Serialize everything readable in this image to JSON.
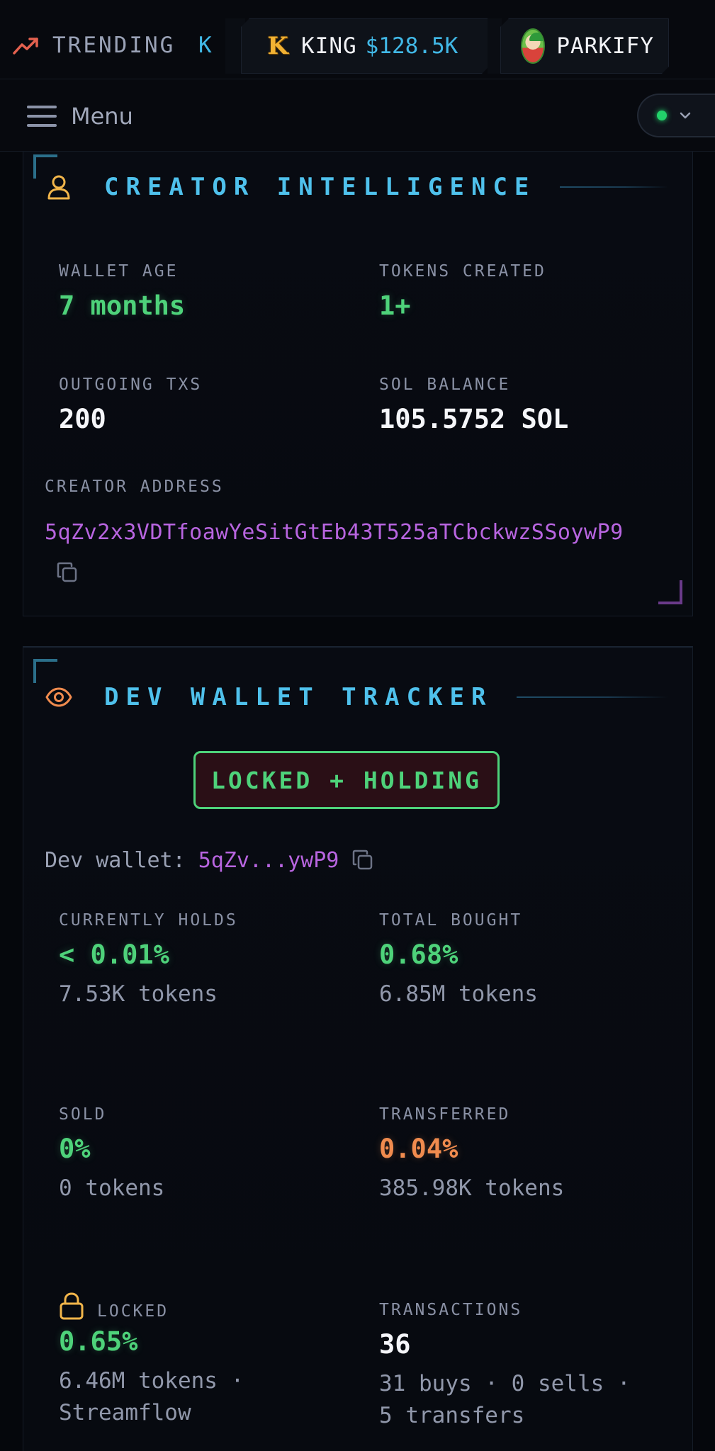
{
  "ticker": {
    "trending_label": "TRENDING",
    "partial_symbol": "K",
    "items": [
      {
        "symbol": "KING",
        "price": "$128.5K",
        "logo_letter": "K"
      },
      {
        "symbol": "PARKIFY"
      }
    ]
  },
  "menu": {
    "label": "Menu",
    "status": "online"
  },
  "creator_intelligence": {
    "title": "CREATOR INTELLIGENCE",
    "wallet_age_label": "WALLET AGE",
    "wallet_age_value": "7 months",
    "tokens_created_label": "TOKENS CREATED",
    "tokens_created_value": "1+",
    "outgoing_txs_label": "OUTGOING TXS",
    "outgoing_txs_value": "200",
    "sol_balance_label": "SOL BALANCE",
    "sol_balance_value": "105.5752 SOL",
    "creator_address_label": "CREATOR ADDRESS",
    "creator_address": "5qZv2x3VDTfoawYeSitGtEb43T525aTCbckwzSSoywP9"
  },
  "dev_wallet_tracker": {
    "title": "DEV WALLET TRACKER",
    "status_badge": "LOCKED + HOLDING",
    "dev_wallet_label": "Dev wallet:",
    "dev_wallet_short": "5qZv...ywP9",
    "currently_holds": {
      "label": "CURRENTLY HOLDS",
      "value": "< 0.01%",
      "sub": "7.53K tokens"
    },
    "total_bought": {
      "label": "TOTAL BOUGHT",
      "value": "0.68%",
      "sub": "6.85M tokens"
    },
    "sold": {
      "label": "SOLD",
      "value": "0%",
      "sub": "0 tokens"
    },
    "transferred": {
      "label": "TRANSFERRED",
      "value": "0.04%",
      "sub": "385.98K tokens"
    },
    "locked": {
      "label": "LOCKED",
      "value": "0.65%",
      "sub_line1": "6.46M tokens ·",
      "sub_line2": "Streamflow"
    },
    "transactions": {
      "label": "TRANSACTIONS",
      "value": "36",
      "sub_line1": "31 buys · 0 sells ·",
      "sub_line2": "5 transfers"
    }
  },
  "colors": {
    "accent_cyan": "#4fc1ec",
    "positive_green": "#4ed27a",
    "warning_orange": "#f08b4e",
    "address_purple": "#b865e0",
    "status_green": "#22d36a"
  },
  "icons": [
    "trending-up-icon",
    "king-logo-icon",
    "parkify-avatar-icon",
    "menu-icon",
    "chevron-down-icon",
    "user-icon",
    "copy-icon",
    "eye-icon",
    "lock-icon"
  ]
}
